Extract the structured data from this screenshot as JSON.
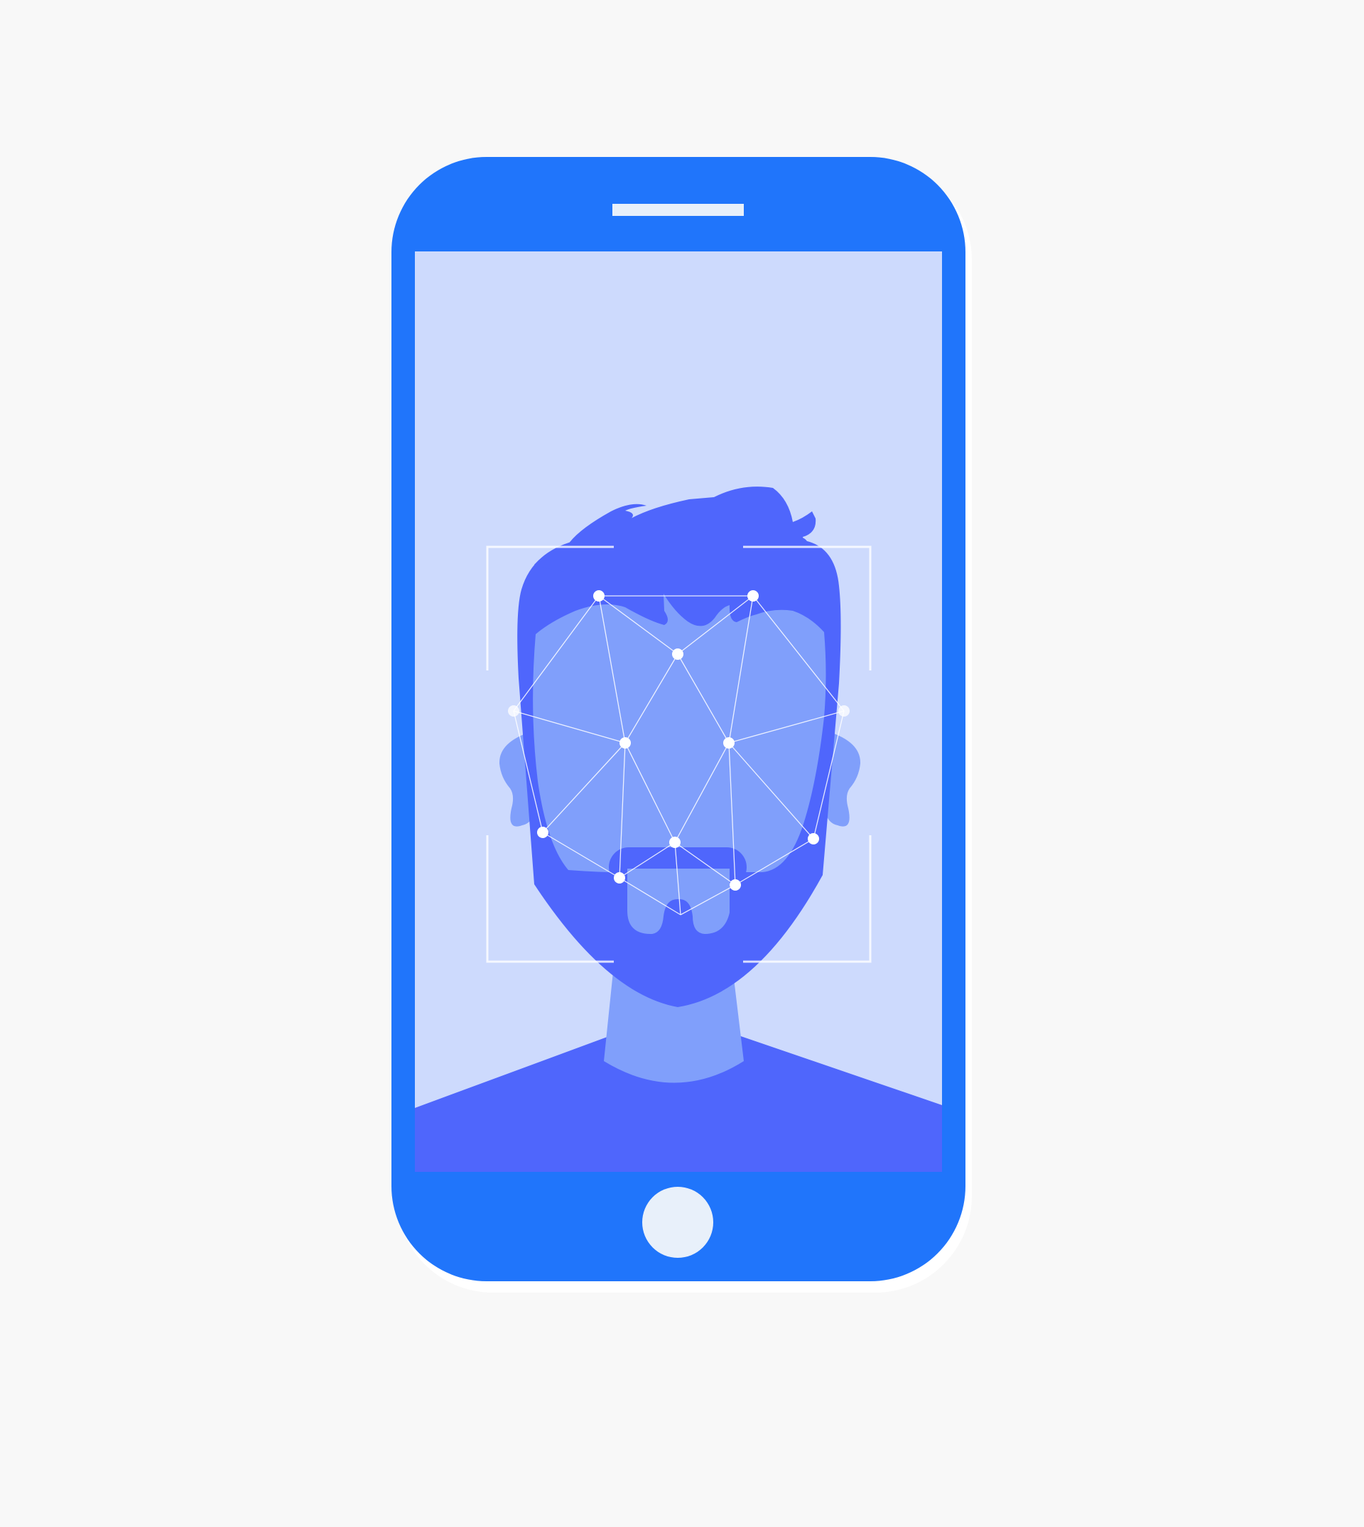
{
  "illustration": {
    "subject": "face-recognition-phone",
    "icons": [
      "phone-icon",
      "speaker-slot-icon",
      "home-button-icon",
      "face-scan-frame-icon",
      "face-mesh-icon"
    ],
    "colors": {
      "background": "#f8f8f8",
      "phone_body": "#2075fb",
      "screen": "#cddafd",
      "silhouette_dark": "#4f66fc",
      "skin": "#809ffb",
      "mesh": "#ffffff",
      "home_button": "#e8f0fa",
      "speaker": "#e8f0fa"
    }
  }
}
